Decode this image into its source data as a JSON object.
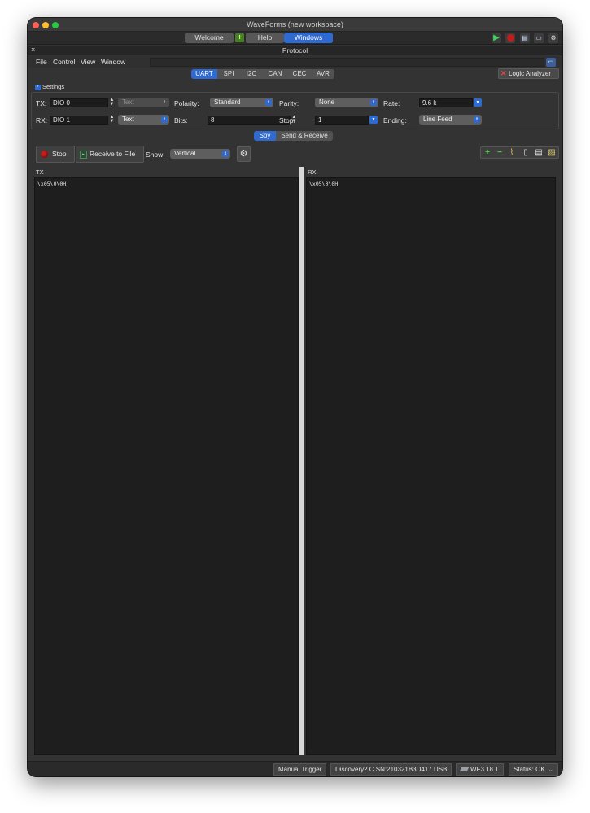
{
  "window": {
    "title": "WaveForms (new workspace)"
  },
  "topbar": {
    "tabs": [
      {
        "label": "Welcome",
        "active": false
      },
      {
        "label": "Help",
        "active": false
      },
      {
        "label": "Windows",
        "active": true
      }
    ],
    "icons": [
      "play-icon",
      "record-icon",
      "windows-icon",
      "layout-icon",
      "gear-icon"
    ]
  },
  "protocol": {
    "title": "Protocol",
    "close_glyph": "×"
  },
  "menu": {
    "items": [
      "File",
      "Control",
      "View",
      "Window"
    ]
  },
  "protocol_tabs": [
    "UART",
    "SPI",
    "I2C",
    "CAN",
    "CEC",
    "AVR"
  ],
  "logic_analyzer": {
    "label": "Logic Analyzer"
  },
  "settings": {
    "label": "Settings",
    "checked": true,
    "tx": {
      "label": "TX:",
      "pin": "DIO 0",
      "format": "Text",
      "format_enabled": false
    },
    "rx": {
      "label": "RX:",
      "pin": "DIO 1",
      "format": "Text"
    },
    "polarity": {
      "label": "Polarity:",
      "value": "Standard"
    },
    "bits": {
      "label": "Bits:",
      "value": "8"
    },
    "parity": {
      "label": "Parity:",
      "value": "None"
    },
    "stop": {
      "label": "Stop:",
      "value": "1"
    },
    "rate": {
      "label": "Rate:",
      "value": "9.6 k"
    },
    "ending": {
      "label": "Ending:",
      "value": "Line Feed"
    }
  },
  "subtabs": [
    "Spy",
    "Send & Receive"
  ],
  "toolbar": {
    "stop_label": "Stop",
    "receive_label": "Receive to File",
    "show_label": "Show:",
    "show_value": "Vertical"
  },
  "panes": {
    "tx": {
      "label": "TX",
      "content": "\\x05\\0\\0H"
    },
    "rx": {
      "label": "RX",
      "content": "\\x05\\0\\0H"
    }
  },
  "status": {
    "manual_trigger": "Manual Trigger",
    "device": "Discovery2 C SN:210321B3D417 USB",
    "version": "WF3.18.1",
    "status": "Status: OK"
  },
  "colors": {
    "accent": "#2f6ad0",
    "background": "#333333",
    "pane": "#1e1e1e",
    "record": "#c41b1b"
  }
}
